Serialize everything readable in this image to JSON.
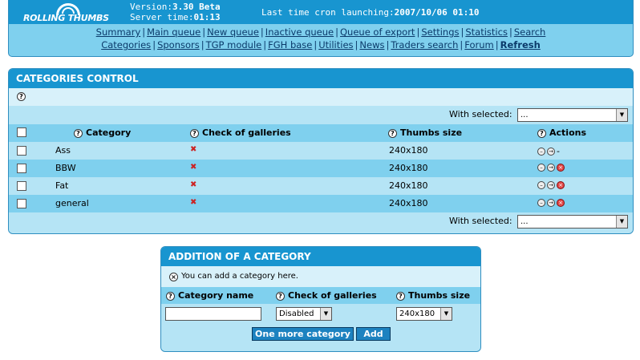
{
  "header": {
    "logo_text": "ROLLING THUMBS",
    "version_label": "Version:",
    "version_value": "3.30 Beta",
    "server_label": "Server time:",
    "server_value": "01:13",
    "cron_label": "Last time cron launching:",
    "cron_value": "2007/10/06 01:10"
  },
  "nav": {
    "row1": [
      "Summary",
      "Main queue",
      "New queue",
      "Inactive queue",
      "Queue of export",
      "Settings",
      "Statistics",
      "Search"
    ],
    "row2": [
      "Categories",
      "Sponsors",
      "TGP module",
      "FGH base",
      "Utilities",
      "News",
      "Traders search",
      "Forum"
    ],
    "refresh": "Refresh"
  },
  "categories_panel": {
    "title": "CATEGORIES CONTROL",
    "with_selected_label": "With selected:",
    "with_selected_value": "...",
    "columns": {
      "category": "Category",
      "check": "Check of galleries",
      "thumbs": "Thumbs size",
      "actions": "Actions"
    },
    "rows": [
      {
        "name": "Ass",
        "thumbs": "240x180",
        "delete": "-"
      },
      {
        "name": "BBW",
        "thumbs": "240x180",
        "delete": ""
      },
      {
        "name": "Fat",
        "thumbs": "240x180",
        "delete": ""
      },
      {
        "name": "general",
        "thumbs": "240x180",
        "delete": ""
      }
    ]
  },
  "add_panel": {
    "title": "ADDITION OF A CATEGORY",
    "info": "You can add a category here.",
    "col_name": "Category name",
    "col_check": "Check of galleries",
    "col_thumbs": "Thumbs size",
    "name_value": "",
    "check_value": "Disabled",
    "thumbs_value": "240x180",
    "btn_more": "One more category",
    "btn_add": "Add"
  },
  "colors": {
    "accent": "#1895d0",
    "panel_bg": "#7fd0ee",
    "row_light": "#d8f1fa",
    "row_mid": "#b5e4f5",
    "nav_text": "#0b3a6a"
  }
}
